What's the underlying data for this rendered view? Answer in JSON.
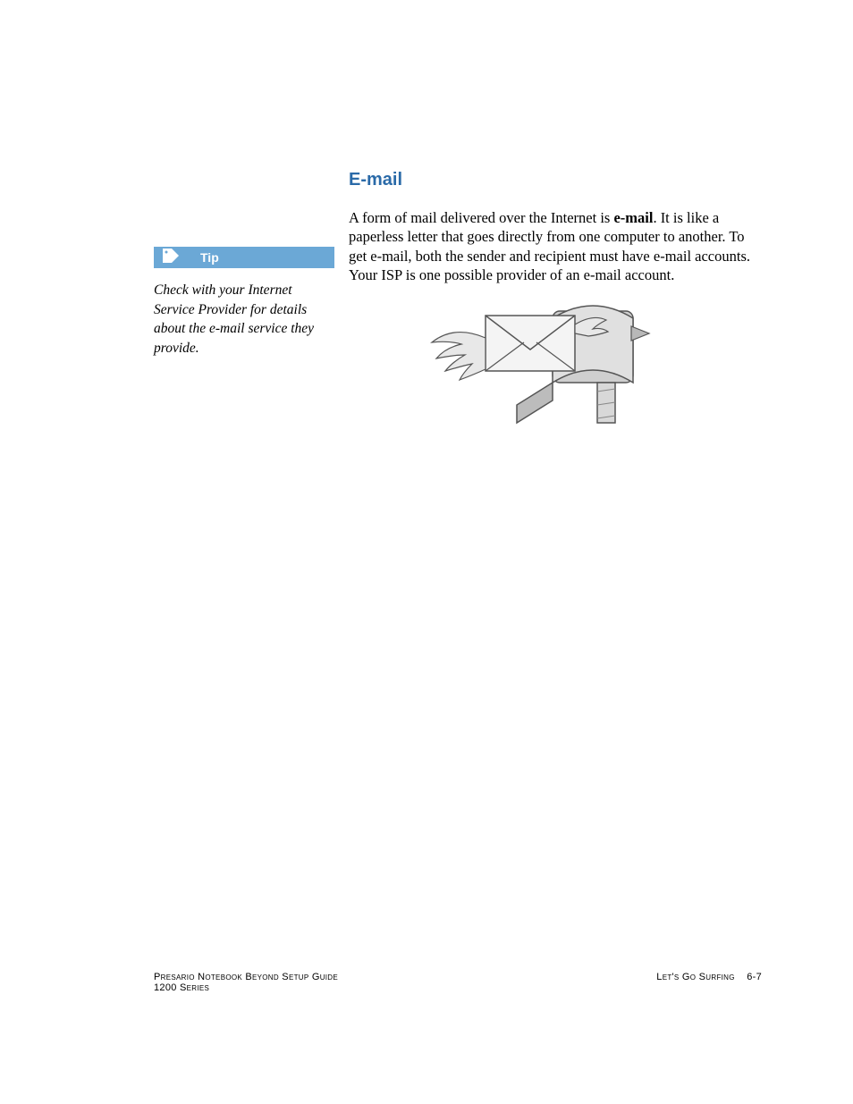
{
  "heading": "E-mail",
  "body": {
    "pre": "A form of mail delivered over the Internet is ",
    "bold": "e-mail",
    "post": ". It is like a paperless letter that goes directly from one computer to another. To get e-mail, both the sender and recipient must have e-mail accounts. Your ISP is one possible provider of an e-mail account."
  },
  "tip": {
    "label": "Tip",
    "text": "Check with your Internet Service Provider for details about the e-mail service they provide.",
    "icon": "tag-icon"
  },
  "footer": {
    "left_line1": "Presario Notebook Beyond Setup Guide",
    "left_line2": "1200 Series",
    "right_section": "Let's Go Surfing",
    "right_page": "6-7"
  },
  "illustration": "mailbox-with-winged-letter"
}
